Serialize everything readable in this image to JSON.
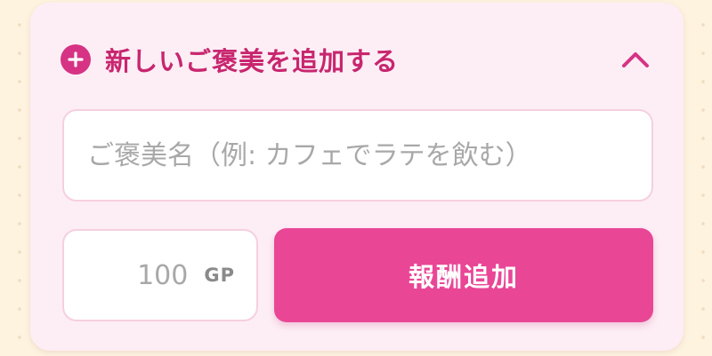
{
  "section": {
    "title": "新しいご褒美を追加する",
    "icons": {
      "add": "plus-circle-icon",
      "collapse": "chevron-up-icon"
    }
  },
  "form": {
    "name_placeholder": "ご褒美名（例: カフェでラテを飲む）",
    "name_value": "",
    "gp_placeholder": "100",
    "gp_value": "",
    "gp_unit": "GP",
    "submit_label": "報酬追加"
  },
  "colors": {
    "accent": "#d63384",
    "button": "#e94696",
    "panel": "#fdeef5",
    "background": "#fdf3df"
  }
}
